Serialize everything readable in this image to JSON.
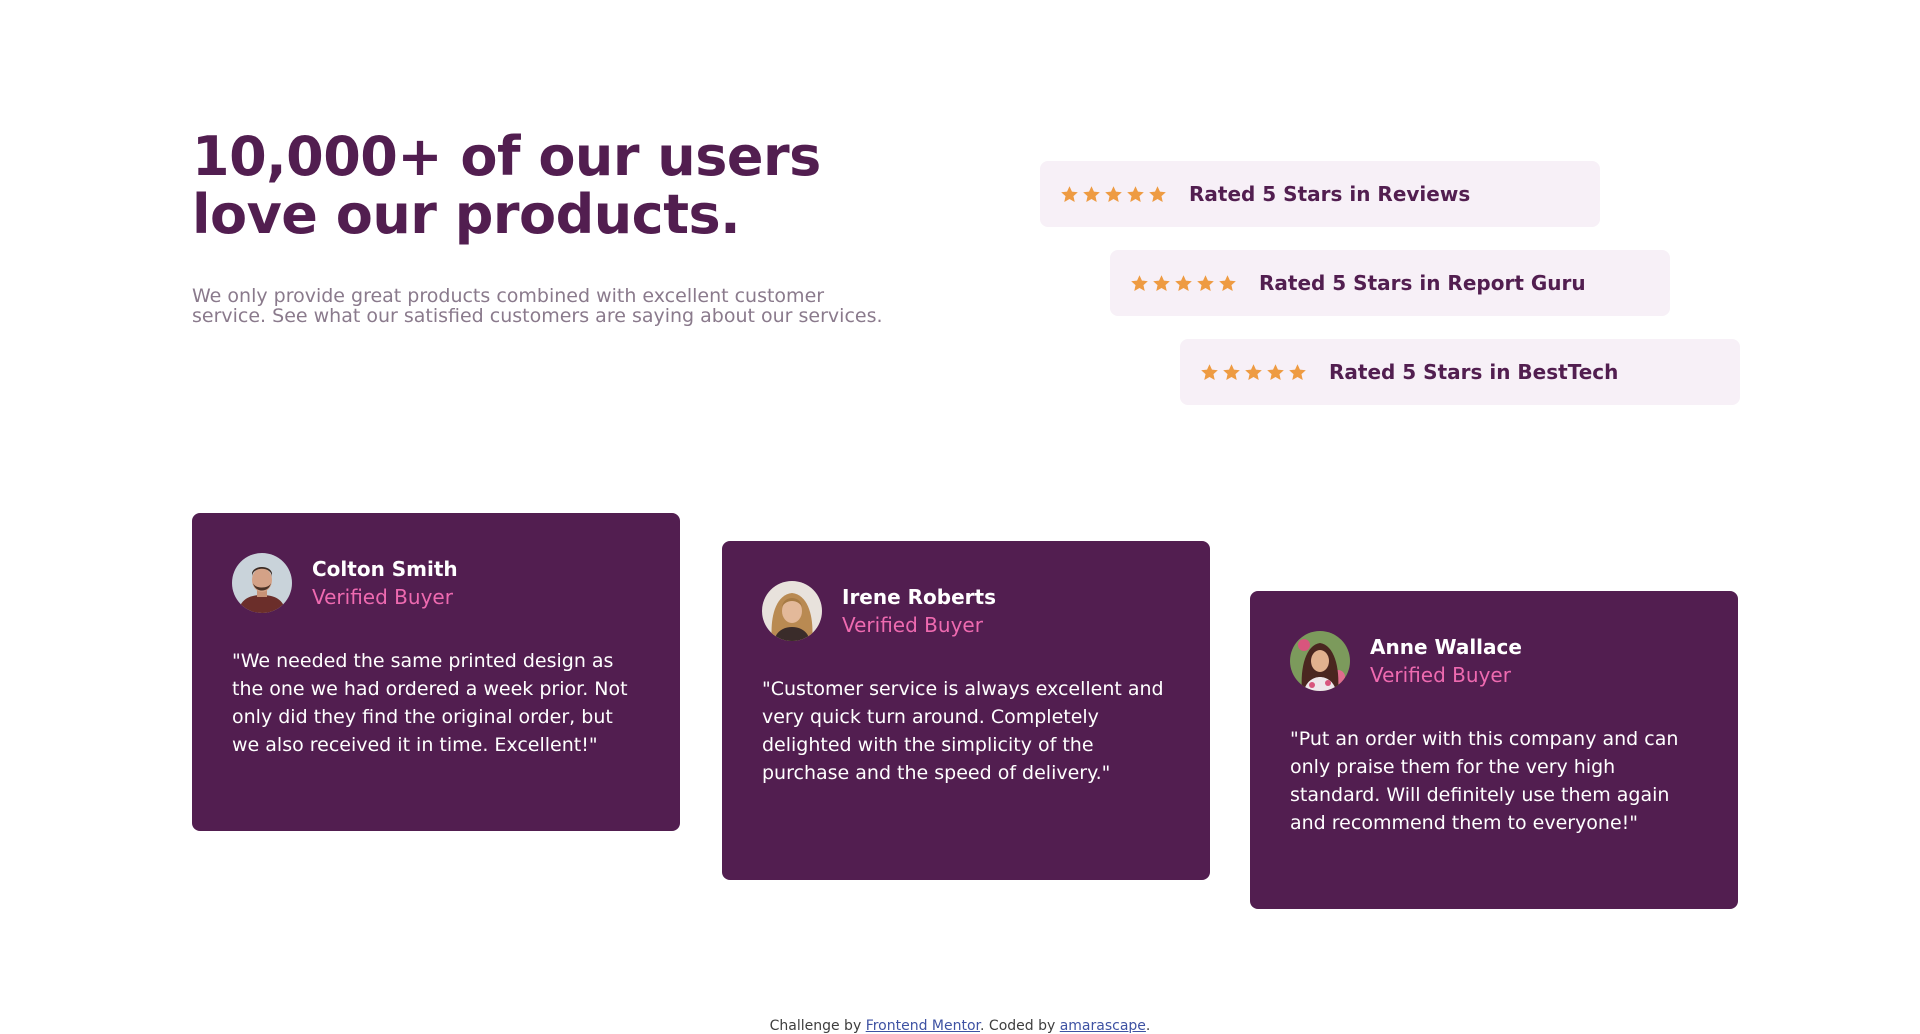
{
  "hero": {
    "headline": "10,000+ of our users love our products.",
    "description": "We only provide great products combined with excellent customer service. See what our satisfied customers are saying about our services."
  },
  "ratings": [
    {
      "label": "Rated 5 Stars in Reviews",
      "stars": 5
    },
    {
      "label": "Rated 5 Stars in Report Guru",
      "stars": 5
    },
    {
      "label": "Rated 5 Stars in BestTech",
      "stars": 5
    }
  ],
  "testimonials": [
    {
      "name": "Colton Smith",
      "role": "Verified Buyer",
      "quote": "\"We needed the same printed design as the one we had ordered a week prior. Not only did they find the original order, but we also received it in time. Excellent!\""
    },
    {
      "name": "Irene Roberts",
      "role": "Verified Buyer",
      "quote": "\"Customer service is always excellent and very quick turn around. Completely delighted with the simplicity of the purchase and the speed of delivery.\""
    },
    {
      "name": "Anne Wallace",
      "role": "Verified Buyer",
      "quote": "\"Put an order with this company and can only praise them for the very high standard. Will definitely use them again and recommend them to everyone!\""
    }
  ],
  "footer": {
    "prefix": "Challenge by ",
    "link1": "Frontend Mentor",
    "middle": ". Coded by ",
    "link2": "amarascape",
    "suffix": "."
  },
  "colors": {
    "primary": "#521e50",
    "accent_pink": "#ee6ab0",
    "star_orange": "#ee9b42",
    "rating_bg": "#f7f0f7",
    "muted_text": "#8a7a8c"
  }
}
